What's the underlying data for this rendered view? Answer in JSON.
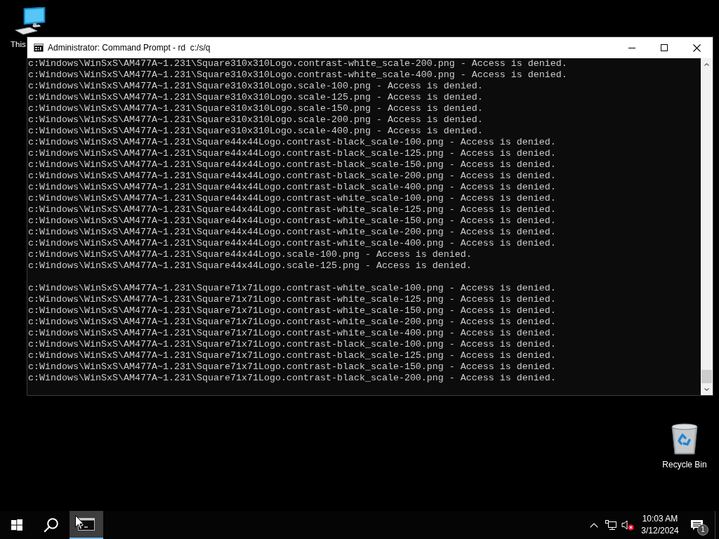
{
  "desktop_icons": [
    {
      "kind": "computer",
      "label": "This"
    },
    {
      "kind": "recycle_bin",
      "label": "Recycle Bin"
    }
  ],
  "window": {
    "title": "Administrator: Command Prompt - rd  c:/s/q",
    "lines": [
      {
        "kind": "text",
        "text": "c:Windows\\WinSxS\\AM477A~1.231\\Square310x310Logo.contrast-white_scale-200.png - Access is denied."
      },
      {
        "kind": "text",
        "text": "c:Windows\\WinSxS\\AM477A~1.231\\Square310x310Logo.contrast-white_scale-400.png - Access is denied."
      },
      {
        "kind": "text",
        "text": "c:Windows\\WinSxS\\AM477A~1.231\\Square310x310Logo.scale-100.png - Access is denied."
      },
      {
        "kind": "text",
        "text": "c:Windows\\WinSxS\\AM477A~1.231\\Square310x310Logo.scale-125.png - Access is denied."
      },
      {
        "kind": "text",
        "text": "c:Windows\\WinSxS\\AM477A~1.231\\Square310x310Logo.scale-150.png - Access is denied."
      },
      {
        "kind": "text",
        "text": "c:Windows\\WinSxS\\AM477A~1.231\\Square310x310Logo.scale-200.png - Access is denied."
      },
      {
        "kind": "text",
        "text": "c:Windows\\WinSxS\\AM477A~1.231\\Square310x310Logo.scale-400.png - Access is denied."
      },
      {
        "kind": "text",
        "text": "c:Windows\\WinSxS\\AM477A~1.231\\Square44x44Logo.contrast-black_scale-100.png - Access is denied."
      },
      {
        "kind": "text",
        "text": "c:Windows\\WinSxS\\AM477A~1.231\\Square44x44Logo.contrast-black_scale-125.png - Access is denied."
      },
      {
        "kind": "text",
        "text": "c:Windows\\WinSxS\\AM477A~1.231\\Square44x44Logo.contrast-black_scale-150.png - Access is denied."
      },
      {
        "kind": "text",
        "text": "c:Windows\\WinSxS\\AM477A~1.231\\Square44x44Logo.contrast-black_scale-200.png - Access is denied."
      },
      {
        "kind": "text",
        "text": "c:Windows\\WinSxS\\AM477A~1.231\\Square44x44Logo.contrast-black_scale-400.png - Access is denied."
      },
      {
        "kind": "text",
        "text": "c:Windows\\WinSxS\\AM477A~1.231\\Square44x44Logo.contrast-white_scale-100.png - Access is denied."
      },
      {
        "kind": "text",
        "text": "c:Windows\\WinSxS\\AM477A~1.231\\Square44x44Logo.contrast-white_scale-125.png - Access is denied."
      },
      {
        "kind": "text",
        "text": "c:Windows\\WinSxS\\AM477A~1.231\\Square44x44Logo.contrast-white_scale-150.png - Access is denied."
      },
      {
        "kind": "text",
        "text": "c:Windows\\WinSxS\\AM477A~1.231\\Square44x44Logo.contrast-white_scale-200.png - Access is denied."
      },
      {
        "kind": "text",
        "text": "c:Windows\\WinSxS\\AM477A~1.231\\Square44x44Logo.contrast-white_scale-400.png - Access is denied."
      },
      {
        "kind": "text",
        "text": "c:Windows\\WinSxS\\AM477A~1.231\\Square44x44Logo.scale-100.png - Access is denied."
      },
      {
        "kind": "text",
        "text": "c:Windows\\WinSxS\\AM477A~1.231\\Square44x44Logo.scale-125.png - Access is denied."
      },
      {
        "kind": "blank"
      },
      {
        "kind": "text",
        "text": "c:Windows\\WinSxS\\AM477A~1.231\\Square71x71Logo.contrast-white_scale-100.png - Access is denied."
      },
      {
        "kind": "text",
        "text": "c:Windows\\WinSxS\\AM477A~1.231\\Square71x71Logo.contrast-white_scale-125.png - Access is denied."
      },
      {
        "kind": "text",
        "text": "c:Windows\\WinSxS\\AM477A~1.231\\Square71x71Logo.contrast-white_scale-150.png - Access is denied."
      },
      {
        "kind": "text",
        "text": "c:Windows\\WinSxS\\AM477A~1.231\\Square71x71Logo.contrast-white_scale-200.png - Access is denied."
      },
      {
        "kind": "text",
        "text": "c:Windows\\WinSxS\\AM477A~1.231\\Square71x71Logo.contrast-white_scale-400.png - Access is denied."
      },
      {
        "kind": "text",
        "text": "c:Windows\\WinSxS\\AM477A~1.231\\Square71x71Logo.contrast-black_scale-100.png - Access is denied."
      },
      {
        "kind": "text",
        "text": "c:Windows\\WinSxS\\AM477A~1.231\\Square71x71Logo.contrast-black_scale-125.png - Access is denied."
      },
      {
        "kind": "text",
        "text": "c:Windows\\WinSxS\\AM477A~1.231\\Square71x71Logo.contrast-black_scale-150.png - Access is denied."
      },
      {
        "kind": "text",
        "text": "c:Windows\\WinSxS\\AM477A~1.231\\Square71x71Logo.contrast-black_scale-200.png - Access is denied."
      }
    ]
  },
  "taskbar": {
    "buttons": [
      {
        "kind": "start",
        "active": false
      },
      {
        "kind": "search",
        "active": false
      },
      {
        "kind": "console",
        "active": true
      }
    ],
    "tray": {
      "volume_muted": true,
      "time": "10:03 AM",
      "date": "3/12/2024",
      "notification_count": "1"
    }
  }
}
